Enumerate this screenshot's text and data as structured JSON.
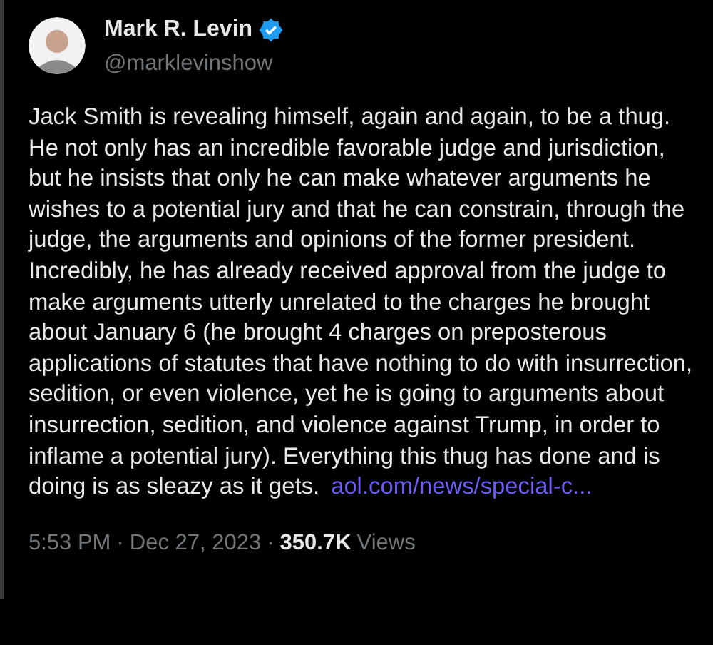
{
  "author": {
    "name": "Mark R. Levin",
    "verified": true,
    "handle": "@marklevinshow"
  },
  "post": {
    "text": "Jack Smith is revealing himself, again and again, to be a thug. He not only has an incredible favorable judge and jurisdiction, but he insists that only he can make whatever arguments he wishes to a potential jury and that he can constrain, through the judge, the arguments and opinions of the former president.  Incredibly, he has already received approval from the judge to make arguments utterly unrelated to the charges he brought about January 6 (he brought 4 charges on preposterous applications of statutes that have nothing to do with insurrection, sedition, or even violence, yet he is going to arguments about insurrection, sedition, and violence against Trump, in order to inflame a potential jury). Everything this thug has done and is doing is as sleazy as it gets.",
    "link": "aol.com/news/special-c..."
  },
  "meta": {
    "time": "5:53 PM",
    "separator_1": "·",
    "date": "Dec 27, 2023",
    "separator_2": "·",
    "views_count": "350.7K",
    "views_label": "Views"
  }
}
